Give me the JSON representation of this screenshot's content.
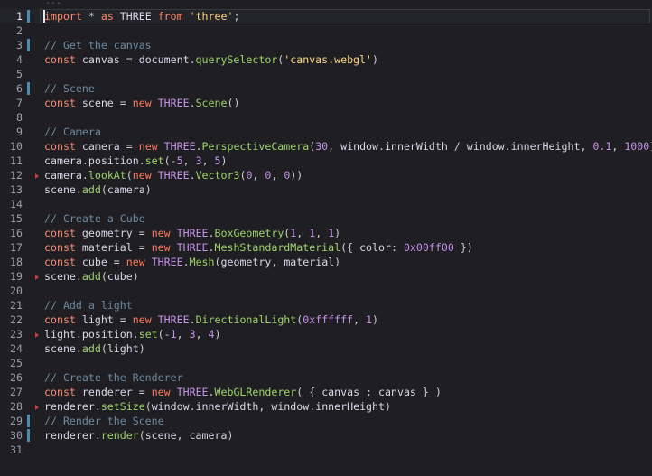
{
  "editor": {
    "fold_hint": "...",
    "lines": [
      {
        "n": "1",
        "active": true,
        "bar": true,
        "marker": false,
        "tokens": [
          [
            "kw",
            "import"
          ],
          [
            "pn",
            " * "
          ],
          [
            "kw",
            "as"
          ],
          [
            "id",
            " THREE "
          ],
          [
            "kw",
            "from"
          ],
          [
            "pn",
            " "
          ],
          [
            "str",
            "'three'"
          ],
          [
            "pn",
            ";"
          ]
        ]
      },
      {
        "n": "2",
        "tokens": []
      },
      {
        "n": "3",
        "bar": true,
        "tokens": [
          [
            "cm",
            "// Get the canvas"
          ]
        ]
      },
      {
        "n": "4",
        "tokens": [
          [
            "kw",
            "const"
          ],
          [
            "id",
            " canvas "
          ],
          [
            "pn",
            "= "
          ],
          [
            "id",
            "document"
          ],
          [
            "pn",
            "."
          ],
          [
            "fn",
            "querySelector"
          ],
          [
            "pn",
            "("
          ],
          [
            "str",
            "'canvas.webgl'"
          ],
          [
            "pn",
            ")"
          ]
        ]
      },
      {
        "n": "5",
        "tokens": []
      },
      {
        "n": "6",
        "bar": true,
        "tokens": [
          [
            "cm",
            "// Scene"
          ]
        ]
      },
      {
        "n": "7",
        "tokens": [
          [
            "kw",
            "const"
          ],
          [
            "id",
            " scene "
          ],
          [
            "pn",
            "= "
          ],
          [
            "kwb",
            "new"
          ],
          [
            "pn",
            " "
          ],
          [
            "obj",
            "THREE"
          ],
          [
            "pn",
            "."
          ],
          [
            "fn",
            "Scene"
          ],
          [
            "pn",
            "()"
          ]
        ]
      },
      {
        "n": "8",
        "tokens": []
      },
      {
        "n": "9",
        "tokens": [
          [
            "cm",
            "// Camera"
          ]
        ]
      },
      {
        "n": "10",
        "tokens": [
          [
            "kw",
            "const"
          ],
          [
            "id",
            " camera "
          ],
          [
            "pn",
            "= "
          ],
          [
            "kwb",
            "new"
          ],
          [
            "pn",
            " "
          ],
          [
            "obj",
            "THREE"
          ],
          [
            "pn",
            "."
          ],
          [
            "fn",
            "PerspectiveCamera"
          ],
          [
            "pn",
            "("
          ],
          [
            "num",
            "30"
          ],
          [
            "pn",
            ", "
          ],
          [
            "id",
            "window"
          ],
          [
            "pn",
            "."
          ],
          [
            "id",
            "innerWidth"
          ],
          [
            "pn",
            " / "
          ],
          [
            "id",
            "window"
          ],
          [
            "pn",
            "."
          ],
          [
            "id",
            "innerHeight"
          ],
          [
            "pn",
            ", "
          ],
          [
            "num",
            "0.1"
          ],
          [
            "pn",
            ", "
          ],
          [
            "num",
            "1000"
          ],
          [
            "pn",
            ")"
          ]
        ]
      },
      {
        "n": "11",
        "tokens": [
          [
            "id",
            "camera"
          ],
          [
            "pn",
            "."
          ],
          [
            "id",
            "position"
          ],
          [
            "pn",
            "."
          ],
          [
            "fn",
            "set"
          ],
          [
            "pn",
            "(-"
          ],
          [
            "num",
            "5"
          ],
          [
            "pn",
            ", "
          ],
          [
            "num",
            "3"
          ],
          [
            "pn",
            ", "
          ],
          [
            "num",
            "5"
          ],
          [
            "pn",
            ")"
          ]
        ]
      },
      {
        "n": "12",
        "marker": true,
        "tokens": [
          [
            "id",
            "camera"
          ],
          [
            "pn",
            "."
          ],
          [
            "fn",
            "lookAt"
          ],
          [
            "pn",
            "("
          ],
          [
            "kwb",
            "new"
          ],
          [
            "pn",
            " "
          ],
          [
            "obj",
            "THREE"
          ],
          [
            "pn",
            "."
          ],
          [
            "fn",
            "Vector3"
          ],
          [
            "pn",
            "("
          ],
          [
            "num",
            "0"
          ],
          [
            "pn",
            ", "
          ],
          [
            "num",
            "0"
          ],
          [
            "pn",
            ", "
          ],
          [
            "num",
            "0"
          ],
          [
            "pn",
            "))"
          ]
        ]
      },
      {
        "n": "13",
        "tokens": [
          [
            "id",
            "scene"
          ],
          [
            "pn",
            "."
          ],
          [
            "fn",
            "add"
          ],
          [
            "pn",
            "("
          ],
          [
            "id",
            "camera"
          ],
          [
            "pn",
            ")"
          ]
        ]
      },
      {
        "n": "14",
        "tokens": []
      },
      {
        "n": "15",
        "tokens": [
          [
            "cm",
            "// Create a Cube"
          ]
        ]
      },
      {
        "n": "16",
        "tokens": [
          [
            "kw",
            "const"
          ],
          [
            "id",
            " geometry "
          ],
          [
            "pn",
            "= "
          ],
          [
            "kwb",
            "new"
          ],
          [
            "pn",
            " "
          ],
          [
            "obj",
            "THREE"
          ],
          [
            "pn",
            "."
          ],
          [
            "fn",
            "BoxGeometry"
          ],
          [
            "pn",
            "("
          ],
          [
            "num",
            "1"
          ],
          [
            "pn",
            ", "
          ],
          [
            "num",
            "1"
          ],
          [
            "pn",
            ", "
          ],
          [
            "num",
            "1"
          ],
          [
            "pn",
            ")"
          ]
        ]
      },
      {
        "n": "17",
        "tokens": [
          [
            "kw",
            "const"
          ],
          [
            "id",
            " material "
          ],
          [
            "pn",
            "= "
          ],
          [
            "kwb",
            "new"
          ],
          [
            "pn",
            " "
          ],
          [
            "obj",
            "THREE"
          ],
          [
            "pn",
            "."
          ],
          [
            "fn",
            "MeshStandardMaterial"
          ],
          [
            "pn",
            "({ "
          ],
          [
            "id",
            "color"
          ],
          [
            "pn",
            ": "
          ],
          [
            "num",
            "0x00ff00"
          ],
          [
            "pn",
            " })"
          ]
        ]
      },
      {
        "n": "18",
        "tokens": [
          [
            "kw",
            "const"
          ],
          [
            "id",
            " cube "
          ],
          [
            "pn",
            "= "
          ],
          [
            "kwb",
            "new"
          ],
          [
            "pn",
            " "
          ],
          [
            "obj",
            "THREE"
          ],
          [
            "pn",
            "."
          ],
          [
            "fn",
            "Mesh"
          ],
          [
            "pn",
            "("
          ],
          [
            "id",
            "geometry"
          ],
          [
            "pn",
            ", "
          ],
          [
            "id",
            "material"
          ],
          [
            "pn",
            ")"
          ]
        ]
      },
      {
        "n": "19",
        "marker": true,
        "tokens": [
          [
            "id",
            "scene"
          ],
          [
            "pn",
            "."
          ],
          [
            "fn",
            "add"
          ],
          [
            "pn",
            "("
          ],
          [
            "id",
            "cube"
          ],
          [
            "pn",
            ")"
          ]
        ]
      },
      {
        "n": "20",
        "tokens": []
      },
      {
        "n": "21",
        "tokens": [
          [
            "cm",
            "// Add a light"
          ]
        ]
      },
      {
        "n": "22",
        "tokens": [
          [
            "kw",
            "const"
          ],
          [
            "id",
            " light "
          ],
          [
            "pn",
            "= "
          ],
          [
            "kwb",
            "new"
          ],
          [
            "pn",
            " "
          ],
          [
            "obj",
            "THREE"
          ],
          [
            "pn",
            "."
          ],
          [
            "fn",
            "DirectionalLight"
          ],
          [
            "pn",
            "("
          ],
          [
            "num",
            "0xffffff"
          ],
          [
            "pn",
            ", "
          ],
          [
            "num",
            "1"
          ],
          [
            "pn",
            ")"
          ]
        ]
      },
      {
        "n": "23",
        "marker": true,
        "tokens": [
          [
            "id",
            "light"
          ],
          [
            "pn",
            "."
          ],
          [
            "id",
            "position"
          ],
          [
            "pn",
            "."
          ],
          [
            "fn",
            "set"
          ],
          [
            "pn",
            "(-"
          ],
          [
            "num",
            "1"
          ],
          [
            "pn",
            ", "
          ],
          [
            "num",
            "3"
          ],
          [
            "pn",
            ", "
          ],
          [
            "num",
            "4"
          ],
          [
            "pn",
            ")"
          ]
        ]
      },
      {
        "n": "24",
        "tokens": [
          [
            "id",
            "scene"
          ],
          [
            "pn",
            "."
          ],
          [
            "fn",
            "add"
          ],
          [
            "pn",
            "("
          ],
          [
            "id",
            "light"
          ],
          [
            "pn",
            ")"
          ]
        ]
      },
      {
        "n": "25",
        "tokens": []
      },
      {
        "n": "26",
        "tokens": [
          [
            "cm",
            "// Create the Renderer"
          ]
        ]
      },
      {
        "n": "27",
        "tokens": [
          [
            "kw",
            "const"
          ],
          [
            "id",
            " renderer "
          ],
          [
            "pn",
            "= "
          ],
          [
            "kwb",
            "new"
          ],
          [
            "pn",
            " "
          ],
          [
            "obj",
            "THREE"
          ],
          [
            "pn",
            "."
          ],
          [
            "fn",
            "WebGLRenderer"
          ],
          [
            "pn",
            "( { "
          ],
          [
            "id",
            "canvas"
          ],
          [
            "pn",
            " : "
          ],
          [
            "id",
            "canvas"
          ],
          [
            "pn",
            " } )"
          ]
        ]
      },
      {
        "n": "28",
        "marker": true,
        "tokens": [
          [
            "id",
            "renderer"
          ],
          [
            "pn",
            "."
          ],
          [
            "fn",
            "setSize"
          ],
          [
            "pn",
            "("
          ],
          [
            "id",
            "window"
          ],
          [
            "pn",
            "."
          ],
          [
            "id",
            "innerWidth"
          ],
          [
            "pn",
            ", "
          ],
          [
            "id",
            "window"
          ],
          [
            "pn",
            "."
          ],
          [
            "id",
            "innerHeight"
          ],
          [
            "pn",
            ")"
          ]
        ]
      },
      {
        "n": "29",
        "bar": true,
        "tokens": [
          [
            "cm",
            "// Render the Scene"
          ]
        ]
      },
      {
        "n": "30",
        "bar": true,
        "tokens": [
          [
            "id",
            "renderer"
          ],
          [
            "pn",
            "."
          ],
          [
            "fn",
            "render"
          ],
          [
            "pn",
            "("
          ],
          [
            "id",
            "scene"
          ],
          [
            "pn",
            ", "
          ],
          [
            "id",
            "camera"
          ],
          [
            "pn",
            ")"
          ]
        ]
      },
      {
        "n": "31",
        "tokens": []
      }
    ]
  }
}
